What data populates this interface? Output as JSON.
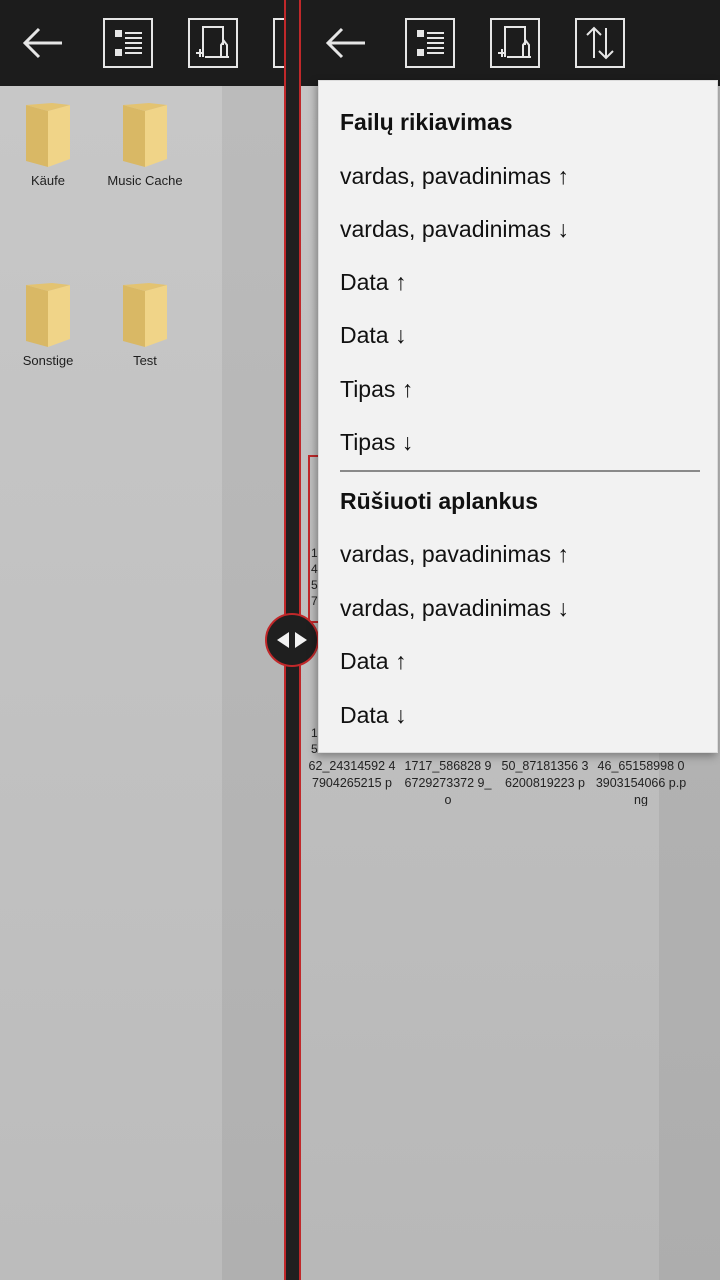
{
  "left_pane": {
    "folders": [
      {
        "label": "Käufe"
      },
      {
        "label": "Music Cache"
      },
      {
        "label": "Sonstige"
      },
      {
        "label": "Test"
      }
    ]
  },
  "right_pane": {
    "partial_chars_top": [
      "1",
      "4",
      "5",
      "7"
    ],
    "partial_chars_bottom": [
      "1",
      "5"
    ],
    "file_names": [
      "62_24314592 47904265215 p",
      "1717_586828 96729273372 9_o",
      "50_87181356 36200819223 p",
      "46_65158998 03903154066 p.png"
    ]
  },
  "toolbar_icons": {
    "back": "back-arrow-icon",
    "details": "details-list-icon",
    "new_folder": "new-folder-icon",
    "sort": "sort-icon"
  },
  "sort_menu": {
    "files_title": "Failų rikiavimas",
    "files_items": [
      "vardas, pavadinimas ↑",
      "vardas, pavadinimas ↓",
      "Data ↑",
      "Data ↓",
      "Tipas ↑",
      "Tipas ↓"
    ],
    "folders_title": "Rūšiuoti aplankus",
    "folders_items": [
      "vardas, pavadinimas ↑",
      "vardas, pavadinimas ↓",
      "Data ↑",
      "Data ↓"
    ]
  },
  "colors": {
    "accent": "#c0282a",
    "toolbar_bg": "#1c1c1c",
    "popup_bg": "#f2f2f2",
    "folder": "#e8c877"
  }
}
